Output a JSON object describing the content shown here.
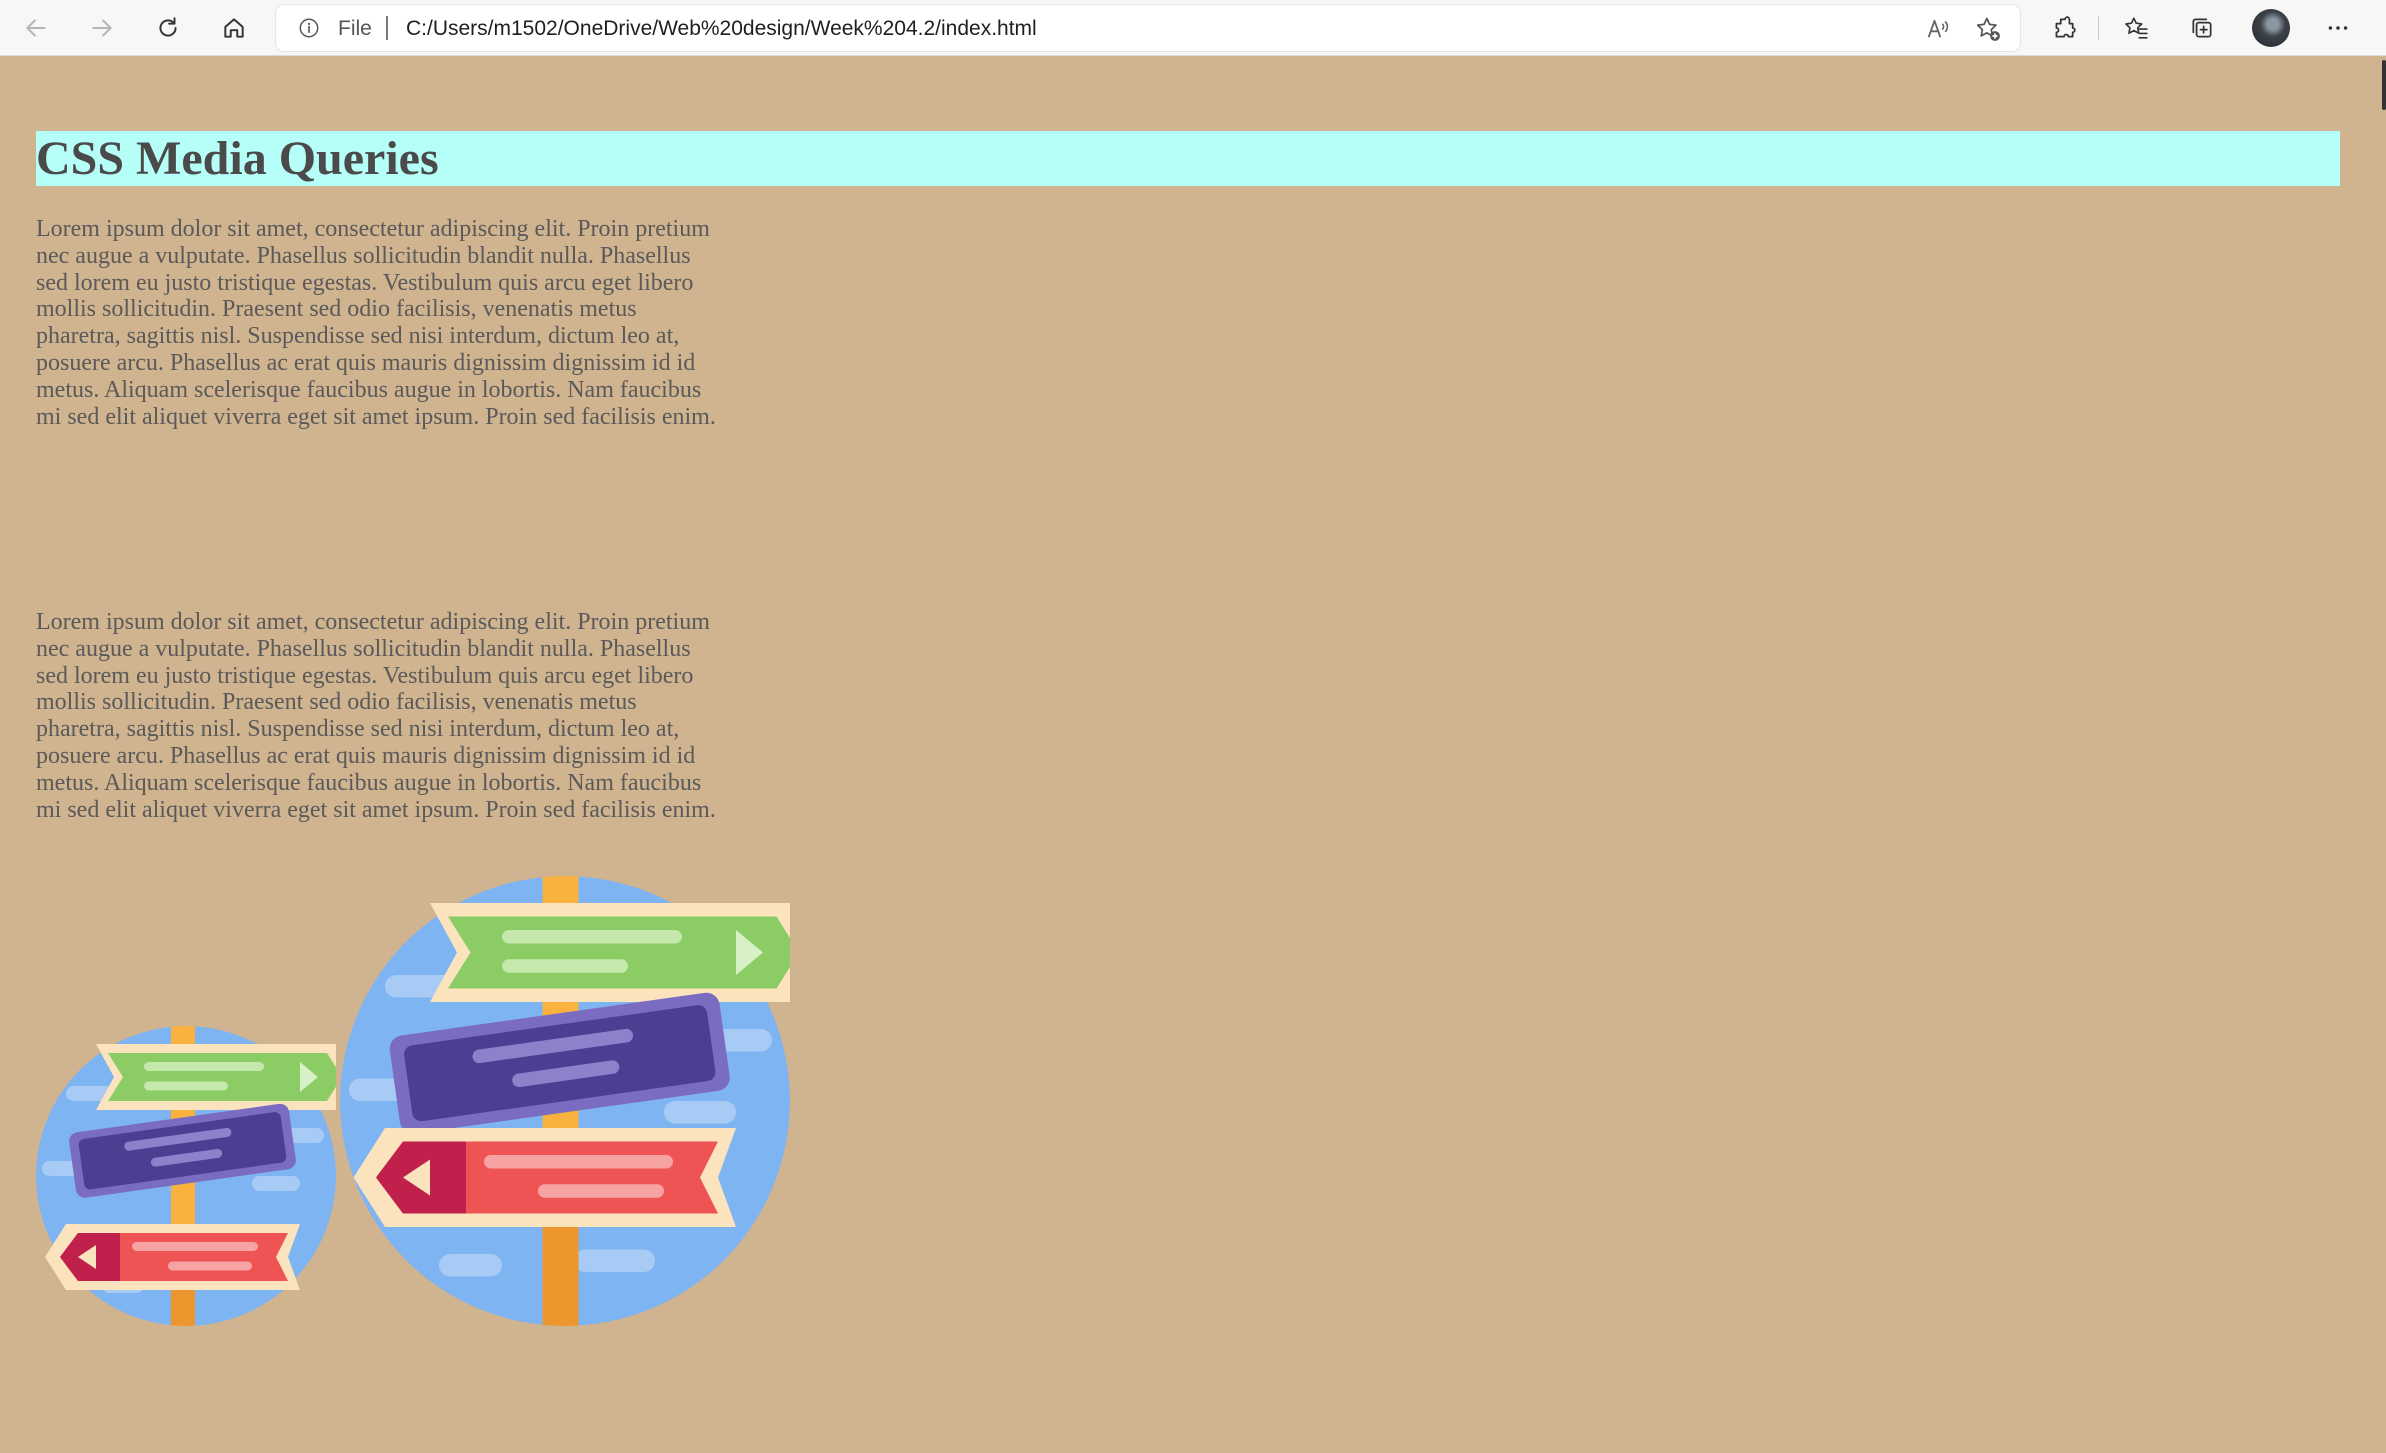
{
  "browser": {
    "address_prefix": "File",
    "url": "C:/Users/m1502/OneDrive/Web%20design/Week%204.2/index.html",
    "icons": {
      "back": "back-arrow-icon",
      "forward": "forward-arrow-icon",
      "refresh": "refresh-icon",
      "home": "home-icon",
      "info": "info-icon",
      "read_aloud": "read-aloud-icon",
      "add_favorite": "add-favorite-icon",
      "extensions": "extensions-icon",
      "favorites": "favorites-icon",
      "collections": "collections-icon",
      "profile": "profile-avatar",
      "more": "more-icon"
    }
  },
  "page": {
    "background": "#d0b38f",
    "heading": "CSS Media Queries",
    "heading_background": "#b6fff9",
    "paragraphs": [
      "Lorem ipsum dolor sit amet, consectetur adipiscing elit. Proin pretium nec augue a vulputate. Phasellus sollicitudin blandit nulla. Phasellus sed lorem eu justo tristique egestas. Vestibulum quis arcu eget libero mollis sollicitudin. Praesent sed odio facilisis, venenatis metus pharetra, sagittis nisl. Suspendisse sed nisi interdum, dictum leo at, posuere arcu. Phasellus ac erat quis mauris dignissim dignissim id id metus. Aliquam scelerisque faucibus augue in lobortis. Nam faucibus mi sed elit aliquet viverra eget sit amet ipsum. Proin sed facilisis enim.",
      "Lorem ipsum dolor sit amet, consectetur adipiscing elit. Proin pretium nec augue a vulputate. Phasellus sollicitudin blandit nulla. Phasellus sed lorem eu justo tristique egestas. Vestibulum quis arcu eget libero mollis sollicitudin. Praesent sed odio facilisis, venenatis metus pharetra, sagittis nisl. Suspendisse sed nisi interdum, dictum leo at, posuere arcu. Phasellus ac erat quis mauris dignissim dignissim id id metus. Aliquam scelerisque faucibus augue in lobortis. Nam faucibus mi sed elit aliquet viverra eget sit amet ipsum. Proin sed facilisis enim."
    ],
    "images": [
      {
        "name": "signpost-illustration-small"
      },
      {
        "name": "signpost-illustration-large"
      }
    ]
  }
}
